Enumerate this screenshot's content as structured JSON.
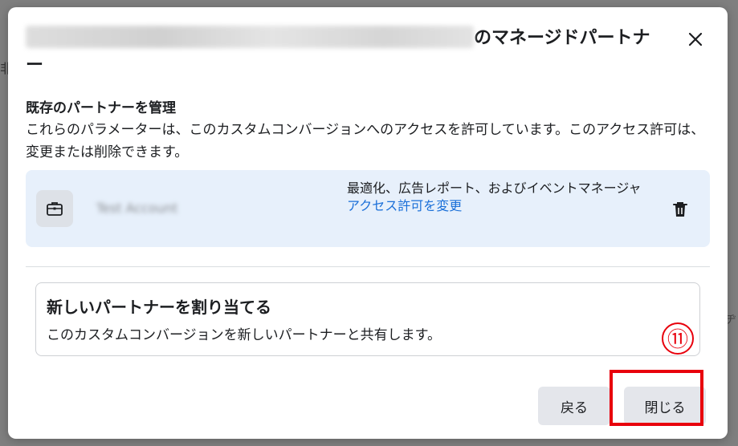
{
  "background": {
    "left_fragment": "非",
    "right_fragment": "ヂ"
  },
  "dialog": {
    "title_suffix": "のマネージドパートナー",
    "close_icon": "close-icon",
    "section_title": "既存のパートナーを管理",
    "description": "これらのパラメーターは、このカスタムコンバージョンへのアクセスを許可しています。このアクセス許可は、変更または削除できます。",
    "partner": {
      "icon": "briefcase-icon",
      "name": "Test Account",
      "permissions": "最適化、広告レポート、およびイベントマネージャ",
      "change_link": "アクセス許可を変更",
      "delete_icon": "trash-icon"
    },
    "assign": {
      "title": "新しいパートナーを割り当てる",
      "description": "このカスタムコンバージョンを新しいパートナーと共有します。"
    },
    "step_marker": "⑪",
    "buttons": {
      "back": "戻る",
      "close": "閉じる"
    }
  },
  "colors": {
    "highlight": "#e8000c",
    "link": "#1a6fd8",
    "card_bg": "#e7f0fb",
    "button_bg": "#e4e6eb"
  }
}
